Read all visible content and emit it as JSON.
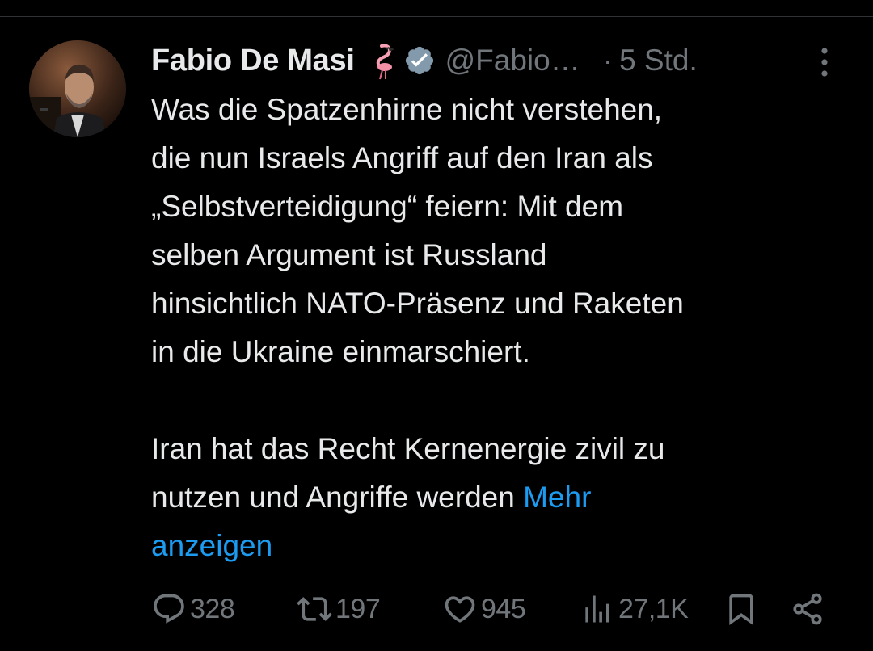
{
  "tweet": {
    "author_name": "Fabio De Masi",
    "name_emoji": "flamingo-emoji",
    "verified": true,
    "handle": "@Fabio…",
    "separator": "·",
    "time": "5 Std.",
    "text_lines": [
      "Was die Spatzenhirne nicht verstehen,",
      "die nun Israels Angriff auf den Iran als",
      "„Selbstverteidigung“ feiern: Mit dem",
      "selben Argument ist Russland",
      "hinsichtlich NATO-Präsenz und Raketen",
      "in die Ukraine einmarschiert."
    ],
    "paragraph2_line1": "Iran hat das Recht Kernenergie zivil zu",
    "paragraph2_line2_prefix": "nutzen und Angriffe werden ",
    "show_more_part1": "Mehr",
    "show_more_part2": "anzeigen"
  },
  "actions": {
    "replies": "328",
    "reposts": "197",
    "likes": "945",
    "views": "27,1K"
  },
  "icons": [
    "avatar",
    "flamingo-emoji",
    "verified-badge-icon",
    "more-options-icon",
    "reply-icon",
    "repost-icon",
    "like-icon",
    "views-icon",
    "bookmark-icon",
    "share-icon"
  ],
  "colors": {
    "background": "#000000",
    "primary_text": "#e7e9ea",
    "secondary_text": "#71767b",
    "link": "#1d9bf0",
    "verified_badge": "#829aab"
  }
}
